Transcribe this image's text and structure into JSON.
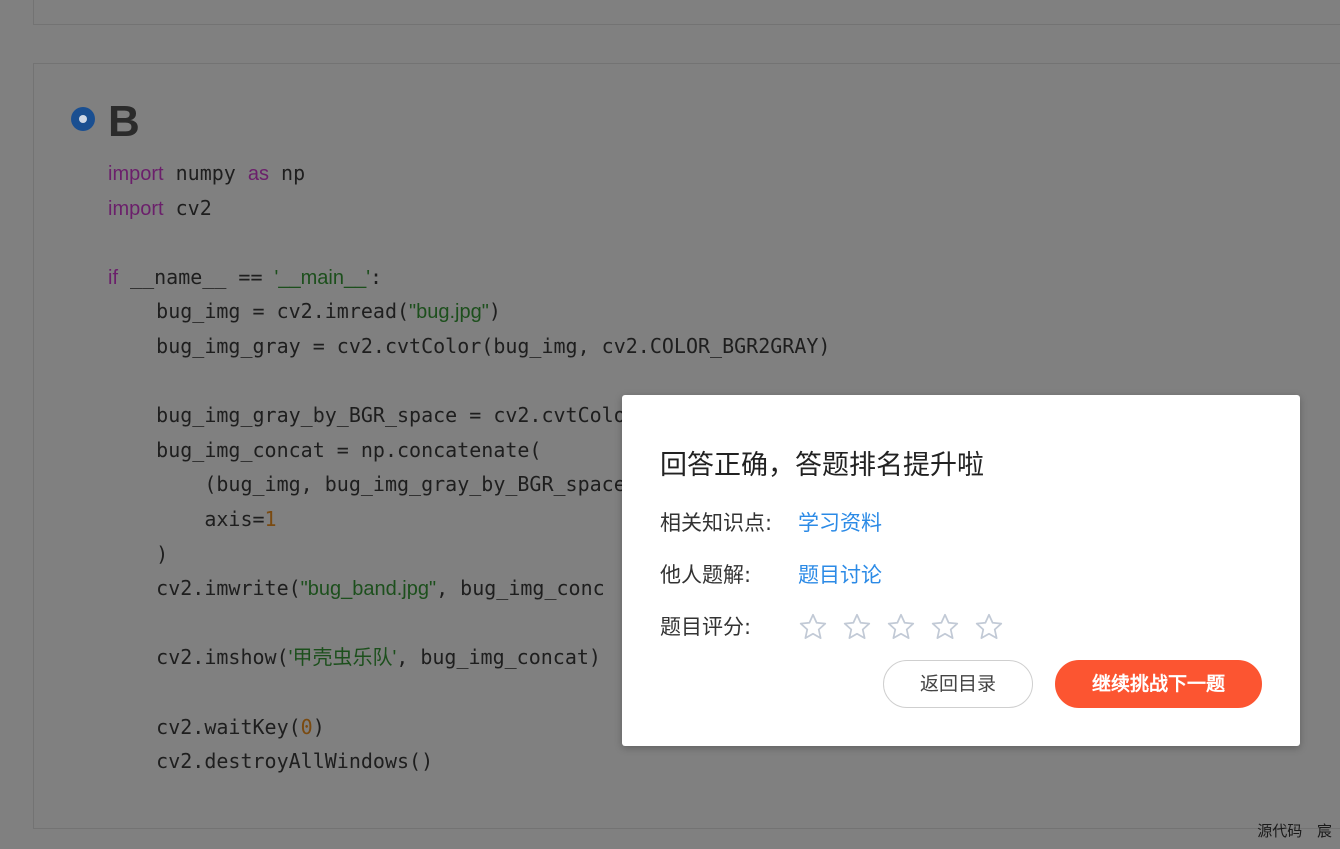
{
  "option": {
    "letter": "B"
  },
  "code_lines": [
    [
      {
        "t": "import",
        "c": "kw"
      },
      {
        "t": " numpy "
      },
      {
        "t": "as",
        "c": "kw"
      },
      {
        "t": " np"
      }
    ],
    [
      {
        "t": "import",
        "c": "kw"
      },
      {
        "t": " cv2"
      }
    ],
    [],
    [
      {
        "t": "if",
        "c": "kw"
      },
      {
        "t": " __name__ == "
      },
      {
        "t": "'__main__'",
        "c": "str"
      },
      {
        "t": ":"
      }
    ],
    [
      {
        "t": "    bug_img = cv2.imread("
      },
      {
        "t": "\"bug.jpg\"",
        "c": "str"
      },
      {
        "t": ")"
      }
    ],
    [
      {
        "t": "    bug_img_gray = cv2.cvtColor(bug_img, cv2.COLOR_BGR2GRAY)"
      }
    ],
    [],
    [
      {
        "t": "    bug_img_gray_by_BGR_space = cv2.cvtColo"
      }
    ],
    [
      {
        "t": "    bug_img_concat = np.concatenate("
      }
    ],
    [
      {
        "t": "        (bug_img, bug_img_gray_by_BGR_space"
      }
    ],
    [
      {
        "t": "        axis="
      },
      {
        "t": "1",
        "c": "num"
      }
    ],
    [
      {
        "t": "    )"
      }
    ],
    [
      {
        "t": "    cv2.imwrite("
      },
      {
        "t": "\"bug_band.jpg\"",
        "c": "str"
      },
      {
        "t": ", bug_img_conc"
      }
    ],
    [],
    [
      {
        "t": "    cv2.imshow("
      },
      {
        "t": "'甲壳虫乐队'",
        "c": "str"
      },
      {
        "t": ", bug_img_concat)"
      }
    ],
    [],
    [
      {
        "t": "    cv2.waitKey("
      },
      {
        "t": "0",
        "c": "num"
      },
      {
        "t": ")"
      }
    ],
    [
      {
        "t": "    cv2.destroyAllWindows()"
      }
    ]
  ],
  "dialog": {
    "title": "回答正确，答题排名提升啦",
    "knowledge_label": "相关知识点:",
    "knowledge_link": "学习资料",
    "solutions_label": "他人题解:",
    "solutions_link": "题目讨论",
    "rating_label": "题目评分:",
    "rating_value": 0,
    "rating_max": 5,
    "back_button": "返回目录",
    "next_button": "继续挑战下一题"
  },
  "colors": {
    "accent": "#fc5531",
    "link": "#2b8ae6",
    "overlay": "#808080"
  },
  "watermark": "源代码 宸"
}
